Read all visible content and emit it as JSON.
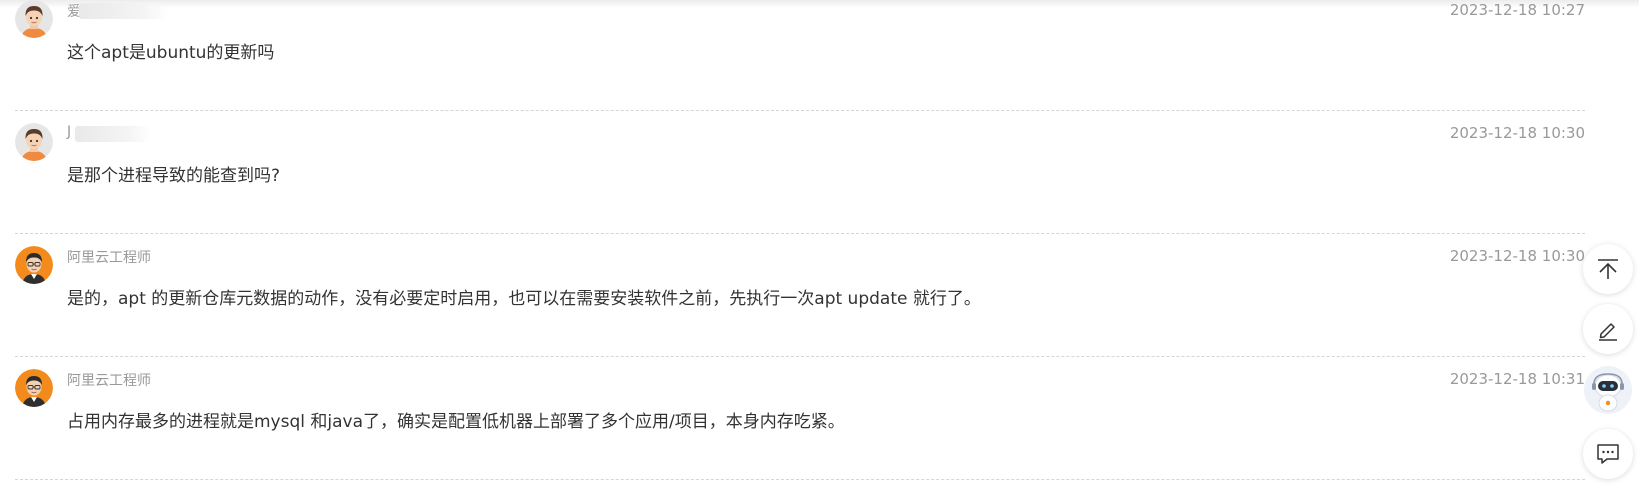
{
  "comments": [
    {
      "author": "爱",
      "author_masked": true,
      "avatar": "cartoon-boy-avatar",
      "timestamp": "2023-12-18 10:27",
      "text": "这个apt是ubuntu的更新吗"
    },
    {
      "author": "J",
      "author_masked": true,
      "avatar": "cartoon-boy-avatar",
      "timestamp": "2023-12-18 10:30",
      "text": "是那个进程导致的能查到吗?"
    },
    {
      "author": "阿里云工程师",
      "author_masked": false,
      "avatar": "engineer-avatar",
      "timestamp": "2023-12-18 10:30",
      "text": "是的，apt 的更新仓库元数据的动作，没有必要定时启用，也可以在需要安装软件之前，先执行一次apt update 就行了。"
    },
    {
      "author": "阿里云工程师",
      "author_masked": false,
      "avatar": "engineer-avatar",
      "timestamp": "2023-12-18 10:31",
      "text": "占用内存最多的进程就是mysql 和java了，确实是配置低机器上部署了多个应用/项目，本身内存吃紧。"
    }
  ],
  "floating_tools": [
    {
      "name": "back-to-top",
      "icon": "arrow-up-to-top-icon"
    },
    {
      "name": "write-comment",
      "icon": "pen-icon"
    },
    {
      "name": "assistant",
      "icon": "robot-assistant-icon"
    },
    {
      "name": "feedback",
      "icon": "chat-bubble-icon"
    }
  ],
  "colors": {
    "text": "#333333",
    "meta": "#999999",
    "divider": "#d6d6d6",
    "engineer_avatar_bg": "#f28b1c",
    "user_avatar_shirt": "#f08a3e"
  }
}
